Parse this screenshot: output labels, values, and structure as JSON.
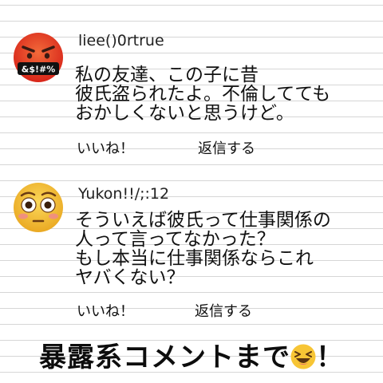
{
  "comments": [
    {
      "username": "liee()0rtrue",
      "avatar_icon": "angry-cursing-face-icon",
      "avatar_symbols": "&$!#%",
      "lines": [
        "私の友達、この子に昔",
        "彼氏盗られたよ。不倫してても",
        "おかしくないと思うけど。"
      ],
      "like_label": "いいね！",
      "reply_label": "返信する"
    },
    {
      "username": "Yukon!!/;:12",
      "avatar_icon": "flushed-face-icon",
      "lines": [
        "そういえば彼氏って仕事関係の",
        "人って言ってなかった？",
        "もし本当に仕事関係ならこれ",
        "ヤバくない？"
      ],
      "like_label": "いいね！",
      "reply_label": "返信する"
    }
  ],
  "caption": {
    "text_before": "暴露系コメントまで",
    "emoji_icon": "laughing-squinting-face-icon",
    "text_after": "！"
  },
  "colors": {
    "angry_red": "#e8341e",
    "emoji_yellow": "#f7c535",
    "line_gray": "#d6d6d6"
  }
}
